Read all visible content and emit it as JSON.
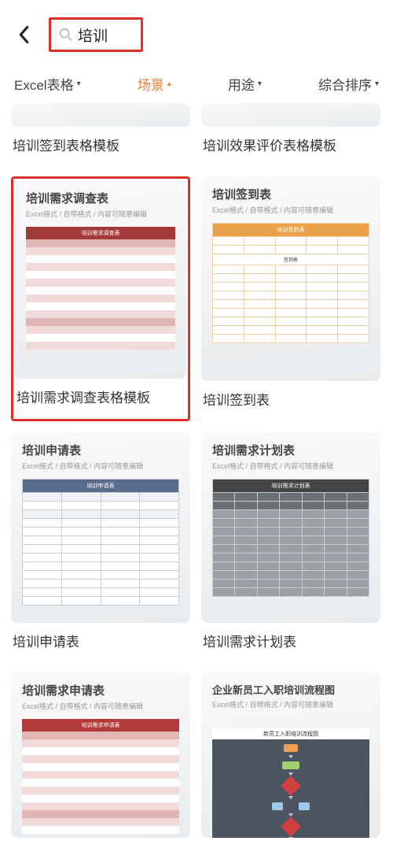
{
  "search": {
    "term": "培训"
  },
  "filters": {
    "f1": "Excel表格",
    "f2": "场景",
    "f3": "用途",
    "f4": "综合排序"
  },
  "results": [
    {
      "title": "培训签到表格模板"
    },
    {
      "title": "培训效果评价表格模板"
    },
    {
      "title": "培训需求调查表格模板",
      "doc_title": "培训需求调查表",
      "subtitle": "Excel格式 / 自带格式 / 内容可随意编辑",
      "inner_header": "培训需求调查表"
    },
    {
      "title": "培训签到表",
      "doc_title": "培训签到表",
      "subtitle": "Excel格式 / 自带格式 / 内容可随意编辑",
      "inner_header": "培训签到表",
      "section": "签到表"
    },
    {
      "title": "培训申请表",
      "doc_title": "培训申请表",
      "subtitle": "Excel格式 / 自带格式 / 内容可随意编辑",
      "inner_header": "培训申请表"
    },
    {
      "title": "培训需求计划表",
      "doc_title": "培训需求计划表",
      "subtitle": "Excel格式 / 自带格式 / 内容可随意编辑",
      "inner_header": "培训需求计划表"
    },
    {
      "title": "",
      "doc_title": "培训需求申请表",
      "subtitle": "Excel格式 / 自带格式 / 内容可随意编辑",
      "inner_header": "培训需求申请表"
    },
    {
      "title": "",
      "doc_title": "企业新员工入职培训流程图",
      "subtitle": "Excel格式 / 自带格式 / 内容可随意编辑",
      "inner_header": "新员工入职培训流程图"
    }
  ]
}
